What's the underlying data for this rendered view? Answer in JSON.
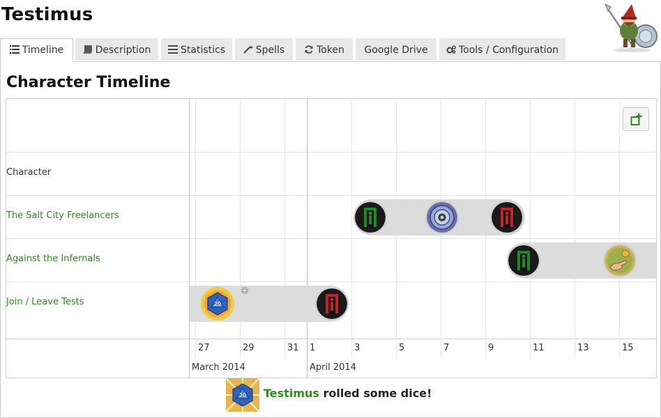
{
  "app": {
    "title": "Testimus"
  },
  "tabs": [
    {
      "label": "Timeline",
      "icon": "list-icon",
      "active": true
    },
    {
      "label": "Description",
      "icon": "book-icon",
      "active": false
    },
    {
      "label": "Statistics",
      "icon": "bars-icon",
      "active": false
    },
    {
      "label": "Spells",
      "icon": "wand-icon",
      "active": false
    },
    {
      "label": "Token",
      "icon": "refresh-icon",
      "active": false
    },
    {
      "label": "Google Drive",
      "icon": "",
      "active": false
    },
    {
      "label": "Tools / Configuration",
      "icon": "gears-icon",
      "active": false
    }
  ],
  "timeline": {
    "title": "Character Timeline",
    "rows": [
      {
        "label": "Character",
        "link": false
      },
      {
        "label": "The Salt City Freelancers",
        "link": true
      },
      {
        "label": "Against the Infernals",
        "link": true
      },
      {
        "label": "Join / Leave Tests",
        "link": true
      }
    ],
    "day_ticks": [
      "27",
      "29",
      "31",
      "1",
      "3",
      "5",
      "7",
      "9",
      "11",
      "13",
      "15"
    ],
    "months": [
      "March 2014",
      "April 2014"
    ],
    "add_button_icon": "add-item-icon"
  },
  "footer": {
    "name": "Testimus",
    "message": " rolled some dice!"
  },
  "colors": {
    "link": "#2e8b1f",
    "tab_bg": "#e8e8e8",
    "bar": "#dcdcdc",
    "enter_token": "#1d8a2a",
    "leave_token": "#c1232b"
  }
}
